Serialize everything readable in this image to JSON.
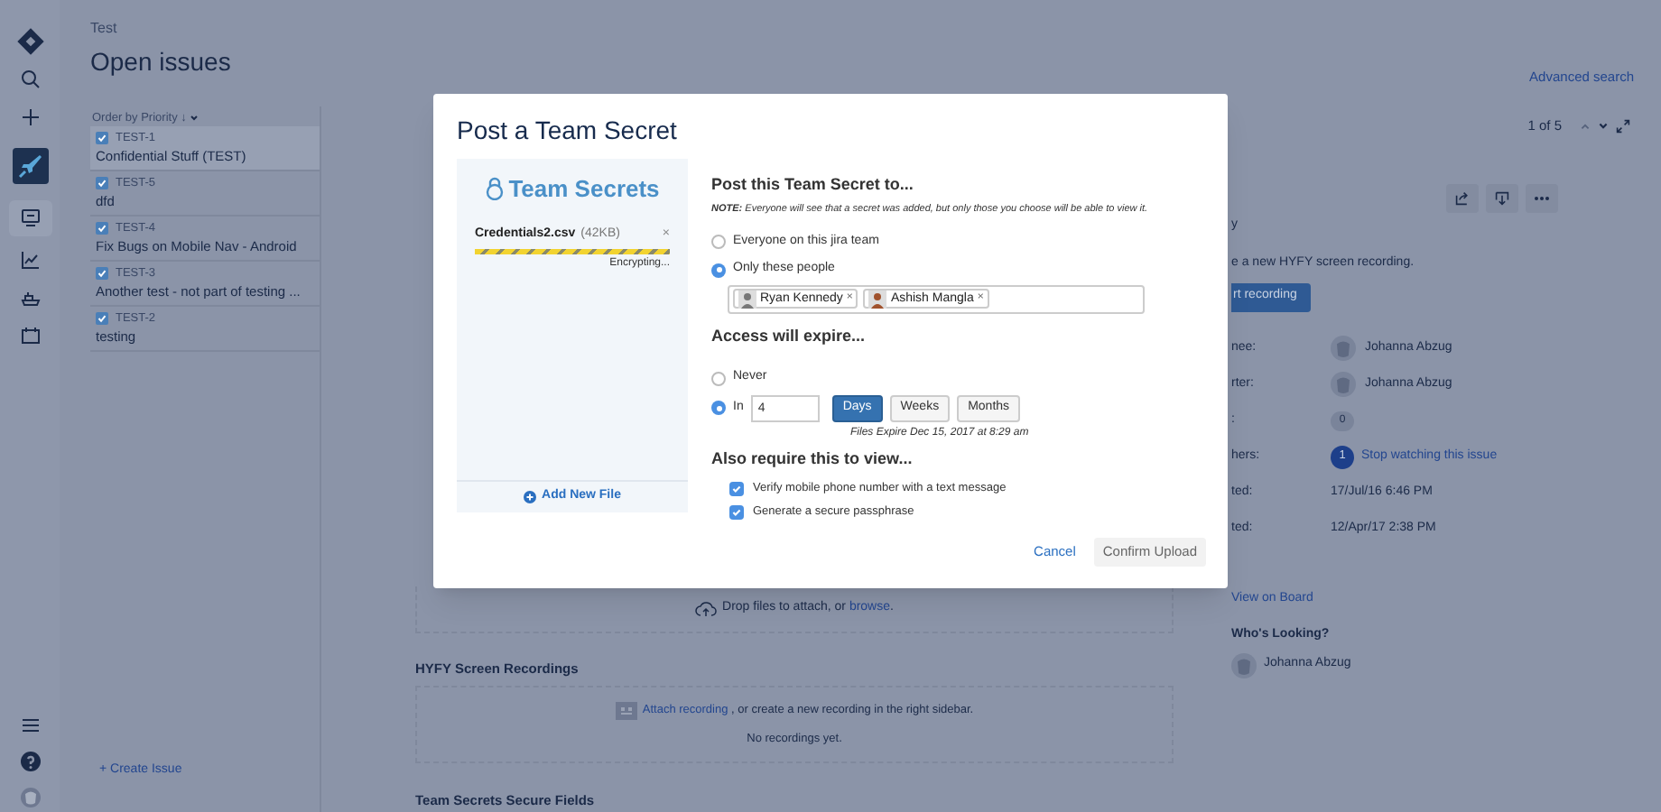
{
  "nav_items": [
    {
      "kind": "logo",
      "selected": false
    },
    {
      "kind": "search",
      "selected": false
    },
    {
      "kind": "create",
      "selected": false
    },
    {
      "kind": "project",
      "selected": false
    },
    {
      "kind": "board",
      "selected": true
    },
    {
      "kind": "reports",
      "selected": false
    },
    {
      "kind": "releases",
      "selected": false
    },
    {
      "kind": "calendar",
      "selected": false
    }
  ],
  "nav_bottom": [
    {
      "kind": "menu"
    },
    {
      "kind": "help"
    },
    {
      "kind": "avatar"
    }
  ],
  "header": {
    "breadcrumb": "Test",
    "title": "Open issues",
    "advanced_search": "Advanced search"
  },
  "issue_list": {
    "order_label": "Order by Priority",
    "sort_arrow": "↓",
    "issues": [
      {
        "key": "TEST-1",
        "summary": "Confidential Stuff (TEST)",
        "selected": true
      },
      {
        "key": "TEST-5",
        "summary": "dfd",
        "selected": false
      },
      {
        "key": "TEST-4",
        "summary": "Fix Bugs on Mobile Nav - Android",
        "selected": false
      },
      {
        "key": "TEST-3",
        "summary": "Another test - not part of testing ...",
        "selected": false
      },
      {
        "key": "TEST-2",
        "summary": "testing",
        "selected": false
      }
    ],
    "create_issue": "+ Create Issue"
  },
  "pager": {
    "text": "1 of 5"
  },
  "details": {
    "heading_fragment": "y",
    "recording_prompt": "e a new HYFY screen recording.",
    "start_button": "rt recording",
    "fields": [
      {
        "label": "nee:",
        "kind": "user",
        "value": "Johanna Abzug"
      },
      {
        "label": "rter:",
        "kind": "user",
        "value": "Johanna Abzug"
      },
      {
        "label": ":",
        "kind": "count",
        "value": "0"
      },
      {
        "label": "hers:",
        "kind": "watch",
        "count": "1",
        "value": "Stop watching this issue"
      },
      {
        "label": "ted:",
        "kind": "date",
        "value": "17/Jul/16 6:46 PM"
      },
      {
        "label": "ted:",
        "kind": "date",
        "value": "12/Apr/17 2:38 PM"
      }
    ],
    "view_on_board": "View on Board",
    "whos_looking": {
      "title": "Who's Looking?",
      "users": [
        "Johanna Abzug"
      ]
    }
  },
  "attachments": {
    "drop_text": "Drop files to attach, or ",
    "browse_link": "browse",
    "drop_suffix": "."
  },
  "recordings": {
    "title": "HYFY Screen Recordings",
    "attach_link": "Attach recording",
    "attach_text": " , or create a new recording in the right sidebar.",
    "empty": "No recordings yet."
  },
  "secure_fields": {
    "title": "Team Secrets Secure Fields"
  },
  "modal": {
    "title": "Post a Team Secret",
    "brand": "Team Secrets",
    "file": {
      "name": "Credentials2.csv",
      "size": "(42KB)",
      "status": "Encrypting...",
      "level": 1,
      "remove": "×"
    },
    "add_file": "Add New File",
    "audience": {
      "title": "Post this Team Secret to...",
      "note": "**NOTE:** Everyone will see that a secret was added, but only those you choose will be able to view it.",
      "options": [
        {
          "label": "Everyone on this jira team",
          "selected": false
        },
        {
          "label": "Only these people",
          "selected": true
        }
      ],
      "people": [
        {
          "name": "Ryan Kennedy",
          "remove": "×"
        },
        {
          "name": "Ashish Mangla",
          "remove": "×"
        }
      ]
    },
    "expiry": {
      "title": "Access will expire...",
      "options": [
        {
          "kind": "never",
          "label": "Never",
          "selected": false
        },
        {
          "kind": "in",
          "label": "In",
          "value": "4",
          "selected": true
        }
      ],
      "units": [
        {
          "label": "Days",
          "selected": true
        },
        {
          "label": "Weeks",
          "selected": false
        },
        {
          "label": "Months",
          "selected": false
        }
      ],
      "note": "Files Expire Dec 15, 2017 at 8:29 am"
    },
    "require": {
      "title": "Also require this to view...",
      "checks": [
        {
          "label": "Verify mobile phone number with a text message",
          "checked": true
        },
        {
          "label": "Generate a secure passphrase",
          "checked": true
        }
      ]
    },
    "cancel": "Cancel",
    "confirm": "Confirm Upload"
  }
}
